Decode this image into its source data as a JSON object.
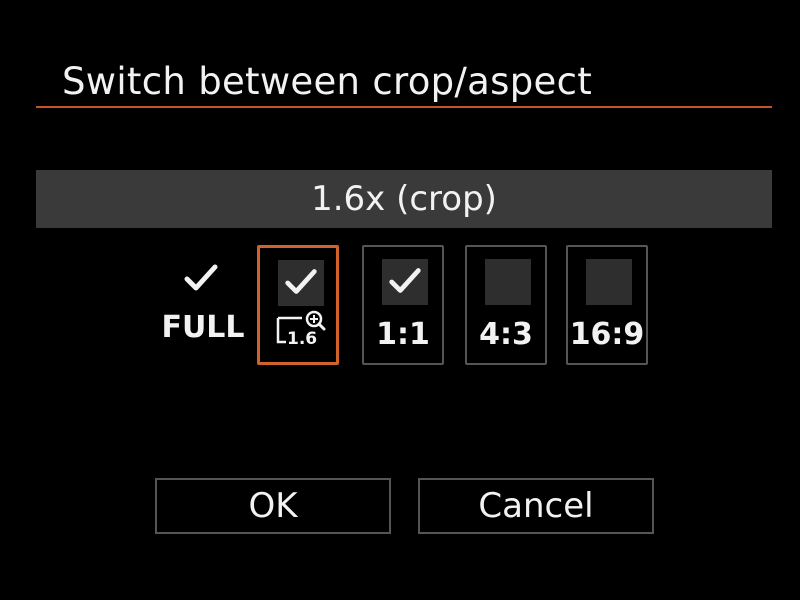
{
  "dialog": {
    "title": "Switch between crop/aspect",
    "current_mode": "1.6x (crop)",
    "accent_color": "#d0632c"
  },
  "options": [
    {
      "label": "FULL",
      "checked": true,
      "has_frame": false,
      "selected": false
    },
    {
      "label": "1.6",
      "icon": "crop-zoom-icon",
      "checked": true,
      "has_frame": true,
      "selected": true
    },
    {
      "label": "1:1",
      "checked": true,
      "has_frame": true,
      "selected": false
    },
    {
      "label": "4:3",
      "checked": false,
      "has_frame": true,
      "selected": false
    },
    {
      "label": "16:9",
      "checked": false,
      "has_frame": true,
      "selected": false
    }
  ],
  "buttons": {
    "ok_label": "OK",
    "cancel_label": "Cancel"
  }
}
